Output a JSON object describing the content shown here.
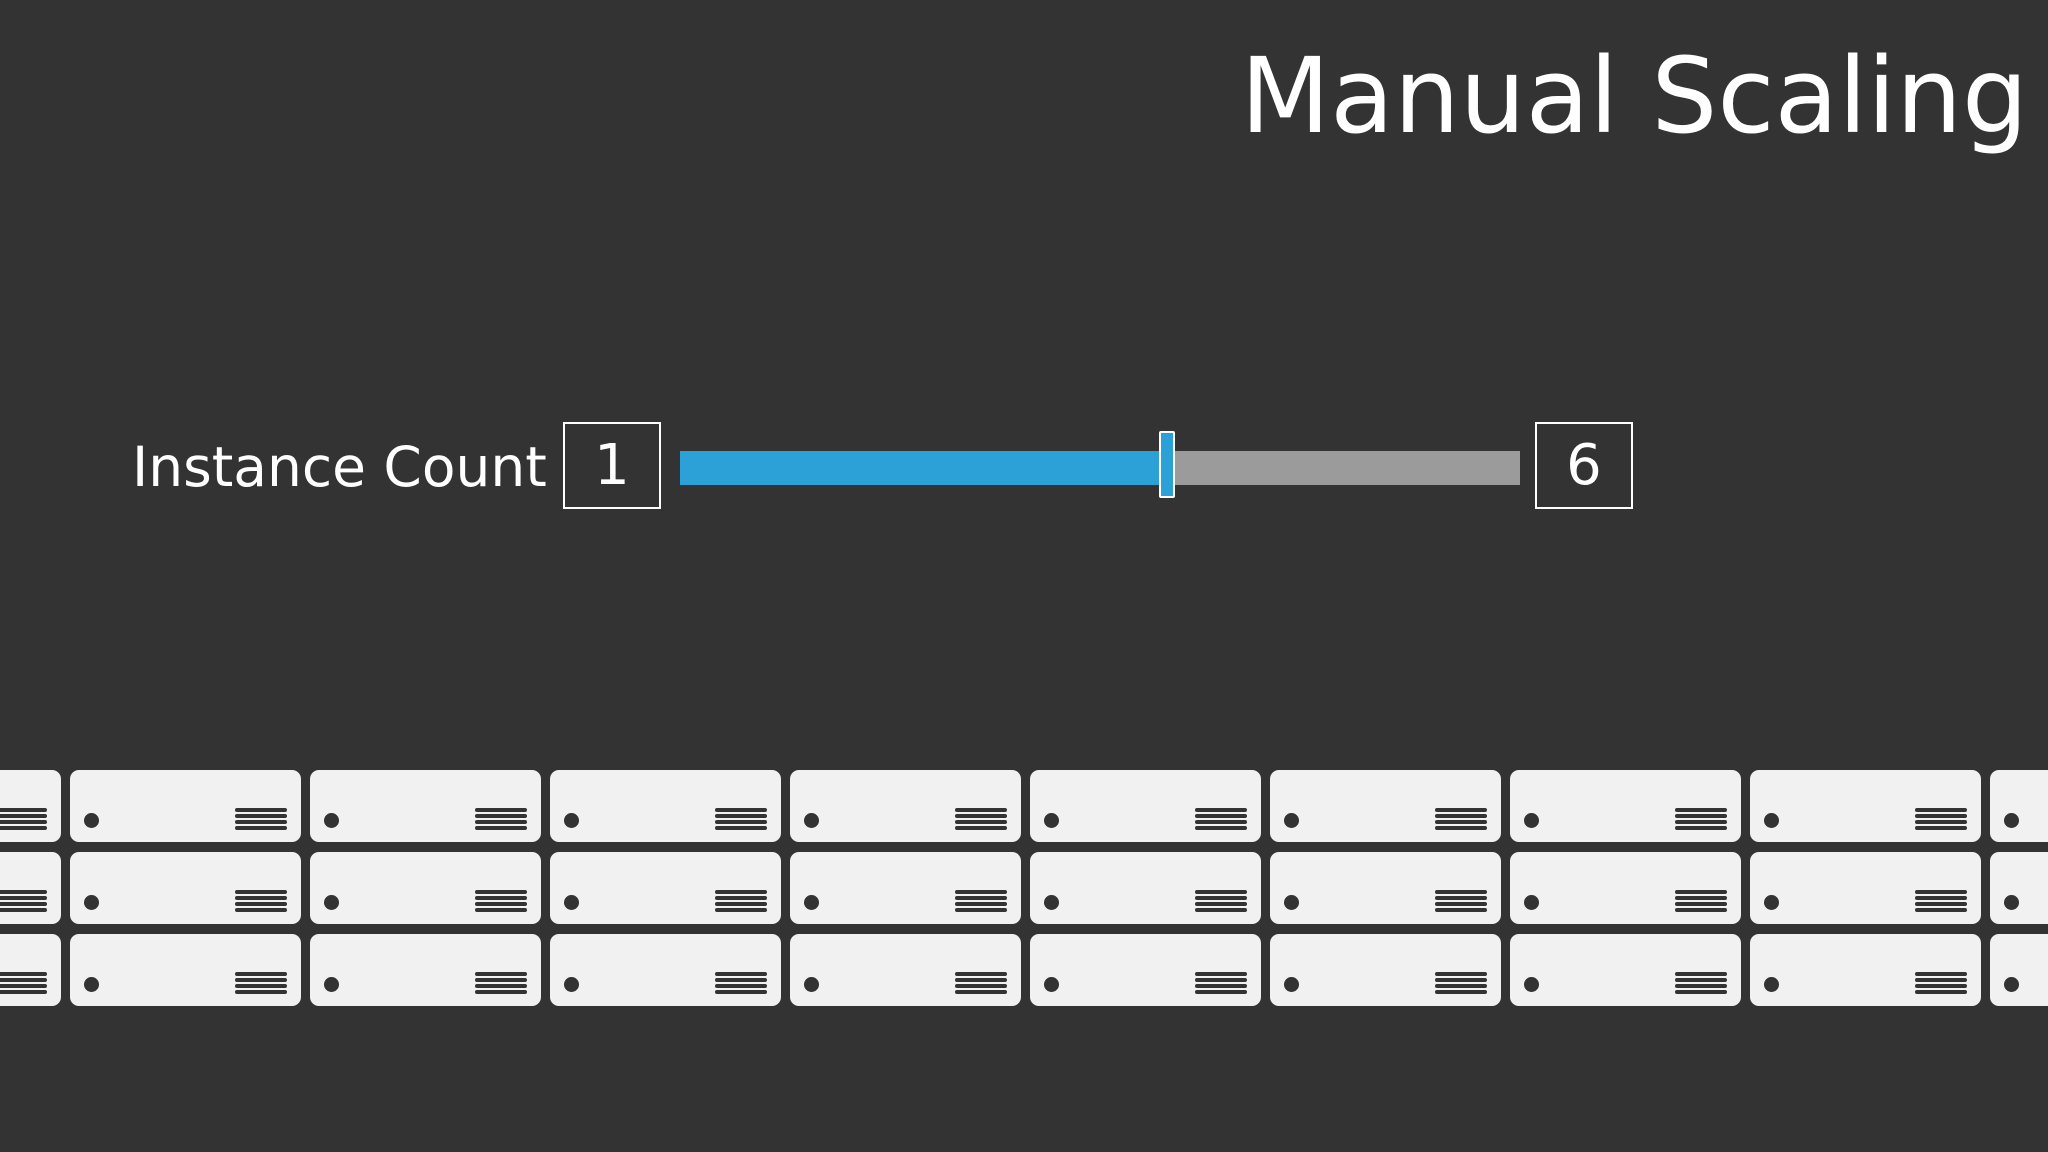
{
  "title": "Manual Scaling",
  "scaler": {
    "label": "Instance Count",
    "min_value": "1",
    "max_value": "6",
    "level_fraction": 0.58,
    "fill_color": "#2ba1d7",
    "track_color": "#9b9b9b"
  },
  "servers": {
    "rows": 3,
    "columns": 10,
    "icon": "server-rack-icon",
    "body_color": "#f1f1f1"
  },
  "colors": {
    "background": "#333334",
    "text": "#ffffff",
    "accent": "#2ba1d7"
  }
}
